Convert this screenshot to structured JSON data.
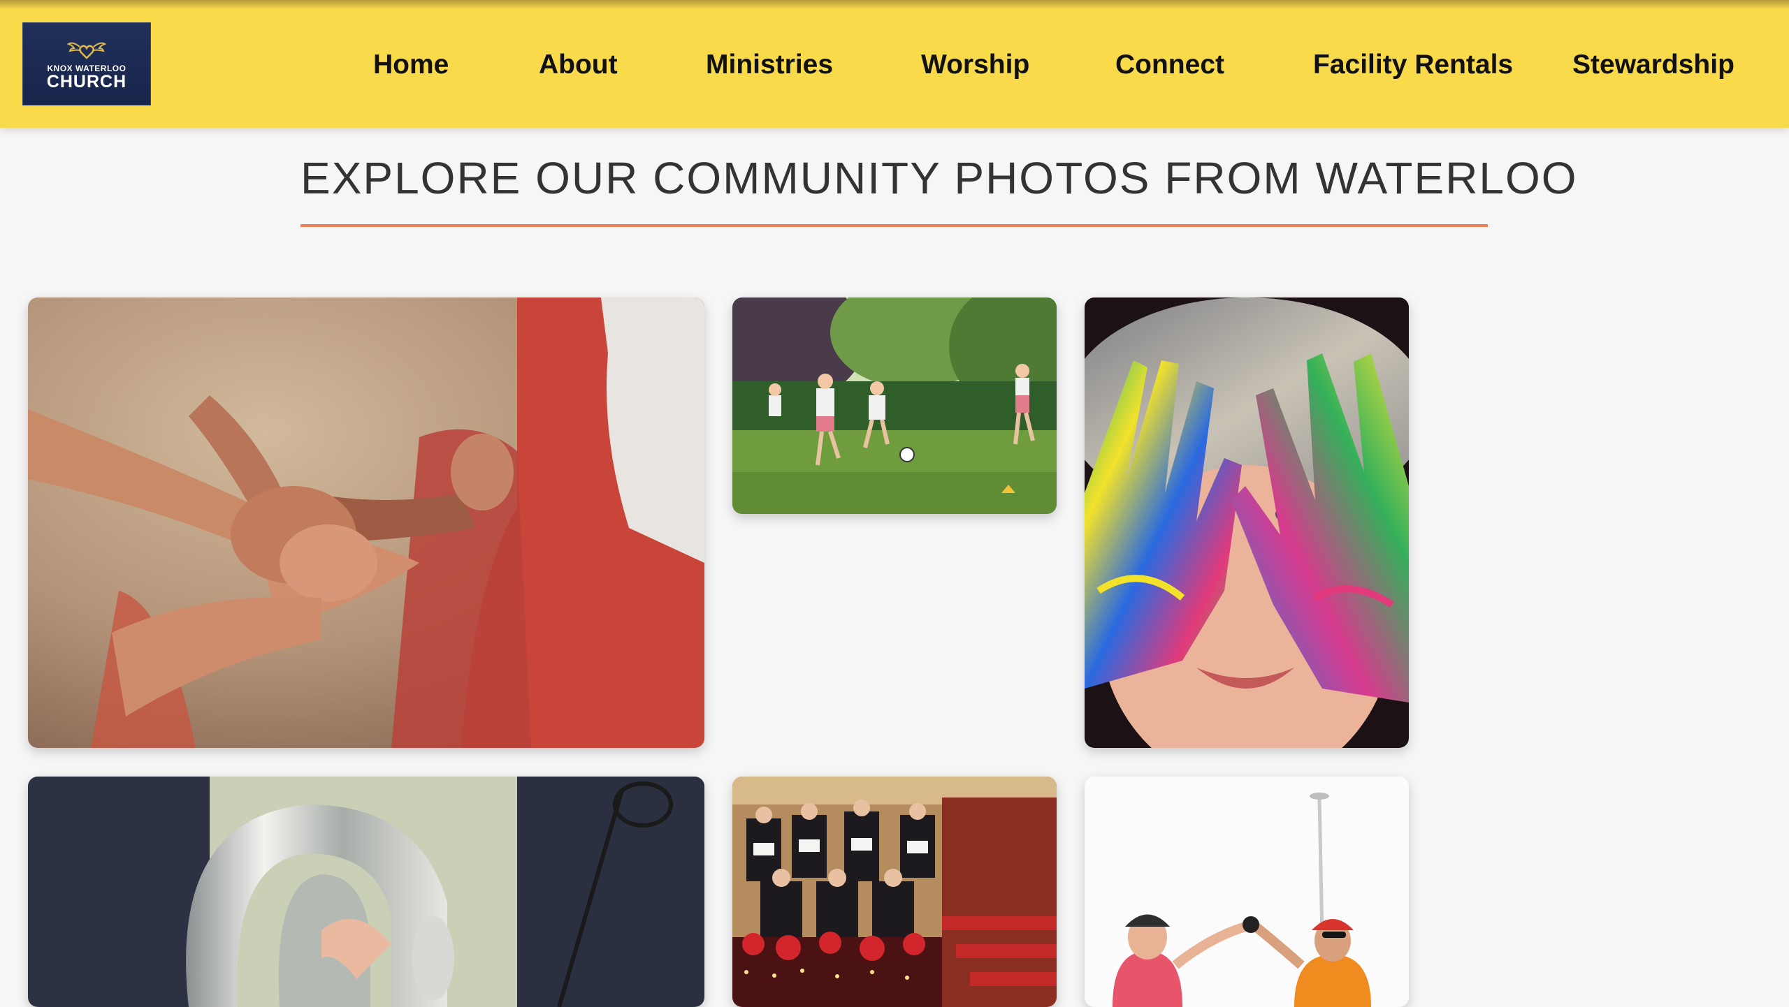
{
  "logo": {
    "line_top": "KNOX WATERLOO",
    "line_main": "CHURCH"
  },
  "nav": [
    {
      "label": "Home"
    },
    {
      "label": "About"
    },
    {
      "label": "Ministries"
    },
    {
      "label": "Worship"
    },
    {
      "label": "Connect"
    },
    {
      "label": "Facility Rentals"
    },
    {
      "label": "Stewardship"
    }
  ],
  "page_title": "EXPLORE OUR COMMUNITY PHOTOS FROM WATERLOO",
  "colors": {
    "header_bg": "#f9da4b",
    "logo_bg": "#1b2a52",
    "accent_rule": "#e9815a",
    "page_bg": "#f6f6f6"
  },
  "gallery": [
    {
      "image": "team-hands-huddle-photo"
    },
    {
      "image": "kids-playing-soccer-photo"
    },
    {
      "image": "child-painted-hands-photo"
    },
    {
      "image": "brass-instrument-photo"
    },
    {
      "image": "church-choir-photo"
    },
    {
      "image": "cyclists-celebrating-photo"
    }
  ]
}
